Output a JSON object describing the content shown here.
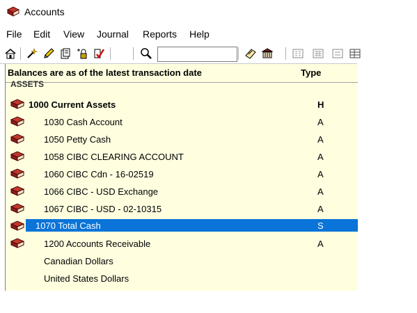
{
  "window": {
    "title": "Accounts",
    "icon": "red-book-icon"
  },
  "menu": [
    "File",
    "Edit",
    "View",
    "Journal",
    "Reports",
    "Help"
  ],
  "toolbar": {
    "icons": [
      "home-icon",
      "settings-wand-icon",
      "edit-pencil-icon",
      "copy-doc-icon",
      "lock-icon",
      "check-icon",
      "search-icon",
      "notes-icon",
      "bank-icon",
      "icon-view-icon",
      "small-icon-view-icon",
      "list-view-icon",
      "details-view-icon"
    ],
    "search_value": ""
  },
  "grid": {
    "header": {
      "name": "Balances are as of the latest transaction date",
      "type": "Type"
    },
    "clipped_section": "ASSETS",
    "rows": [
      {
        "name": "1000 Current Assets",
        "type": "H",
        "bold": true,
        "icon": true
      },
      {
        "name": "1030 Cash Account",
        "type": "A",
        "icon": true
      },
      {
        "name": "1050 Petty Cash",
        "type": "A",
        "icon": true
      },
      {
        "name": "1058 CIBC CLEARING ACCOUNT",
        "type": "A",
        "icon": true
      },
      {
        "name": "1060 CIBC Cdn - 16-02519",
        "type": "A",
        "icon": true
      },
      {
        "name": "1066 CIBC - USD Exchange",
        "type": "A",
        "icon": true
      },
      {
        "name": "1067 CIBC - USD - 02-10315",
        "type": "A",
        "icon": true
      },
      {
        "name": "1070 Total Cash",
        "type": "S",
        "icon": true,
        "selected": true
      },
      {
        "name": "1200 Accounts Receivable",
        "type": "A",
        "icon": true
      },
      {
        "name": "Canadian Dollars",
        "type": "",
        "icon": false
      },
      {
        "name": "United States Dollars",
        "type": "",
        "icon": false
      }
    ]
  }
}
